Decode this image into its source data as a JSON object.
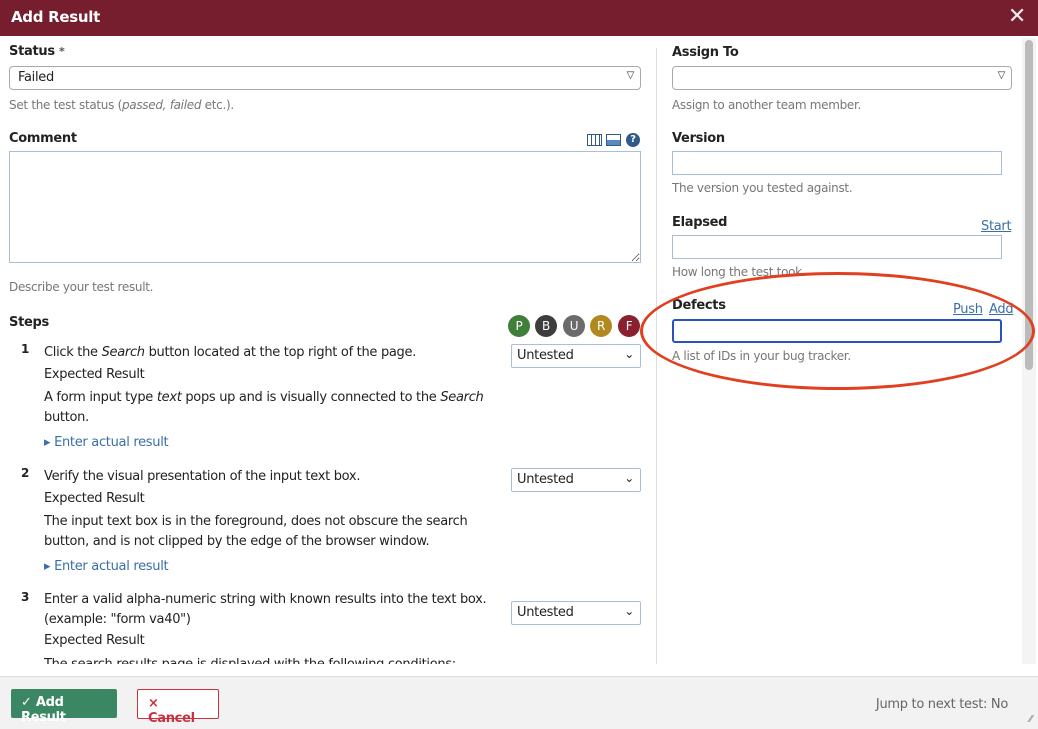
{
  "header": {
    "title": "Add Result",
    "close_icon": "close-icon"
  },
  "left": {
    "status_label": "Status",
    "status_required": "*",
    "status_value": "Failed",
    "status_hint_pre": "Set the test status (",
    "status_hint_i1": "passed, ",
    "status_hint_i2": "failed",
    "status_hint_post": " etc.).",
    "comment_label": "Comment",
    "comment_hint": "Describe your test result.",
    "steps_label": "Steps",
    "badges": [
      {
        "label": "P",
        "color": "#3f7f3a"
      },
      {
        "label": "B",
        "color": "#3d3d3d"
      },
      {
        "label": "U",
        "color": "#6b6b6b"
      },
      {
        "label": "R",
        "color": "#b08a21"
      },
      {
        "label": "F",
        "color": "#8a1f2e"
      }
    ],
    "steps": [
      {
        "num": "1",
        "desc_pre": "Click the ",
        "desc_i": "Search",
        "desc_post": " button located at the top right of the page.",
        "expected_label": "Expected Result",
        "expected_pre": "A form input type ",
        "expected_i": "text",
        "expected_mid": " pops up and is visually connected to the ",
        "expected_i2": "Search",
        "expected_post": " button.",
        "status": "Untested",
        "actual_link": "Enter actual result"
      },
      {
        "num": "2",
        "desc": "Verify the visual presentation of the input text box.",
        "expected_label": "Expected Result",
        "expected": "The input text box is in the foreground, does not obscure the search button, and is not clipped by the edge of the browser window.",
        "status": "Untested",
        "actual_link": "Enter actual result"
      },
      {
        "num": "3",
        "desc": "Enter a valid alpha-numeric string with known results into the text box. (example: \"form va40\")",
        "expected_label": "Expected Result",
        "expected": "The search results page is displayed with the following conditions:",
        "status": "Untested"
      }
    ]
  },
  "right": {
    "assign_label": "Assign To",
    "assign_value": "",
    "assign_hint": "Assign to another team member.",
    "version_label": "Version",
    "version_hint": "The version you tested against.",
    "elapsed_label": "Elapsed",
    "elapsed_start": "Start",
    "elapsed_hint": "How long the test took.",
    "defects_label": "Defects",
    "defects_push": "Push",
    "defects_add": "Add",
    "defects_hint": "A list of IDs in your bug tracker."
  },
  "footer": {
    "add_label": "Add Result",
    "cancel_label": "Cancel",
    "jump_label": "Jump to next test: No"
  },
  "colors": {
    "header": "#761d2e",
    "add_button": "#3b8764",
    "cancel": "#c8323e",
    "annotation": "#e04020"
  }
}
